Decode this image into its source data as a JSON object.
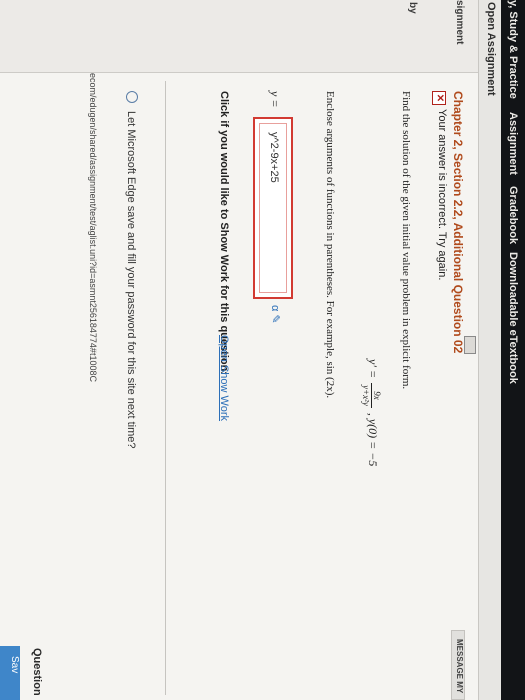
{
  "nav": {
    "study_practice": "y, Study & Practice",
    "assignment": "Assignment",
    "gradebook": "Gradebook",
    "etextbook": "Downloadable eTextbook"
  },
  "subbar": {
    "title": "Open Assignment"
  },
  "left_rail": {
    "label_a": "signment",
    "label_b": "by"
  },
  "question": {
    "title": "Chapter 2, Section 2.2, Additional Question 02",
    "status": "Your answer is incorrect.  Try again.",
    "prompt": "Find the solution of the given initial value problem in explicit form.",
    "equation_lhs": "y′ =",
    "equation_num": "9x",
    "equation_den": "y+x²y",
    "equation_rhs": ",   y(0) = −5",
    "instruction": "Enclose arguments of functions in parentheses. For example, sin (2x).",
    "answer_label": "y =",
    "answer_value": "y^2-9x+25",
    "show_work_prompt": "Click if you would like to Show Work for this question:",
    "show_work_link": "Open Show Work"
  },
  "edge_prompt": "Let Microsoft Edge save and fill your password for this site next time?",
  "url_text": "ecom/edugen/shared/assignment/test/aglist.uni?id=asmnt256184774#t1008C",
  "right_rail": {
    "message_button": "MESSAGE MY",
    "question_label": "Question",
    "save_button": "Sav"
  },
  "colors": {
    "title": "#b04a1c",
    "error": "#d23a32",
    "link": "#2c6fb8",
    "nav_bg": "#121417"
  }
}
